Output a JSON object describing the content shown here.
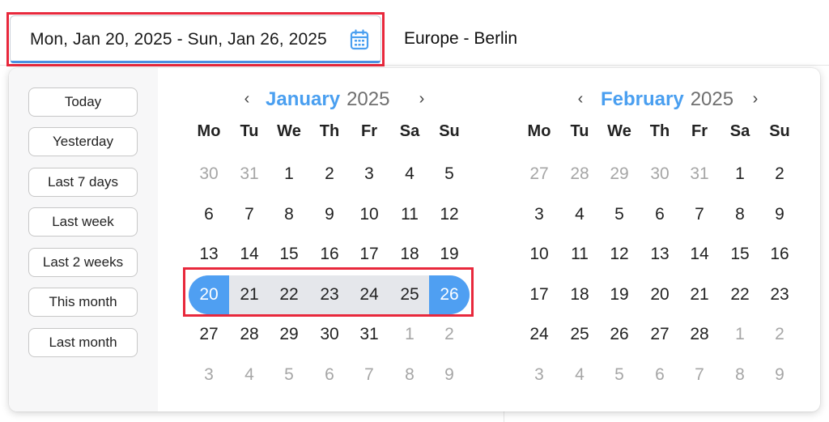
{
  "date_range": {
    "value": "Mon, Jan 20, 2025 - Sun, Jan 26, 2025",
    "icon": "calendar-icon"
  },
  "timezone": "Europe - Berlin",
  "presets": [
    "Today",
    "Yesterday",
    "Last 7 days",
    "Last week",
    "Last 2 weeks",
    "This month",
    "Last month"
  ],
  "weekdays": [
    "Mo",
    "Tu",
    "We",
    "Th",
    "Fr",
    "Sa",
    "Su"
  ],
  "months": [
    {
      "name": "January",
      "year": "2025",
      "weeks": [
        [
          {
            "d": "30",
            "muted": true
          },
          {
            "d": "31",
            "muted": true
          },
          {
            "d": "1"
          },
          {
            "d": "2"
          },
          {
            "d": "3"
          },
          {
            "d": "4"
          },
          {
            "d": "5"
          }
        ],
        [
          {
            "d": "6"
          },
          {
            "d": "7"
          },
          {
            "d": "8"
          },
          {
            "d": "9"
          },
          {
            "d": "10"
          },
          {
            "d": "11"
          },
          {
            "d": "12"
          }
        ],
        [
          {
            "d": "13"
          },
          {
            "d": "14"
          },
          {
            "d": "15"
          },
          {
            "d": "16"
          },
          {
            "d": "17"
          },
          {
            "d": "18"
          },
          {
            "d": "19"
          }
        ],
        [
          {
            "d": "20",
            "selected": true
          },
          {
            "d": "21",
            "inrange": true
          },
          {
            "d": "22",
            "inrange": true
          },
          {
            "d": "23",
            "inrange": true
          },
          {
            "d": "24",
            "inrange": true
          },
          {
            "d": "25",
            "inrange": true
          },
          {
            "d": "26",
            "selected": true
          }
        ],
        [
          {
            "d": "27"
          },
          {
            "d": "28"
          },
          {
            "d": "29"
          },
          {
            "d": "30"
          },
          {
            "d": "31"
          },
          {
            "d": "1",
            "muted": true
          },
          {
            "d": "2",
            "muted": true
          }
        ],
        [
          {
            "d": "3",
            "muted": true
          },
          {
            "d": "4",
            "muted": true
          },
          {
            "d": "5",
            "muted": true
          },
          {
            "d": "6",
            "muted": true
          },
          {
            "d": "7",
            "muted": true
          },
          {
            "d": "8",
            "muted": true
          },
          {
            "d": "9",
            "muted": true
          }
        ]
      ]
    },
    {
      "name": "February",
      "year": "2025",
      "weeks": [
        [
          {
            "d": "27",
            "muted": true
          },
          {
            "d": "28",
            "muted": true
          },
          {
            "d": "29",
            "muted": true
          },
          {
            "d": "30",
            "muted": true
          },
          {
            "d": "31",
            "muted": true
          },
          {
            "d": "1"
          },
          {
            "d": "2"
          }
        ],
        [
          {
            "d": "3"
          },
          {
            "d": "4"
          },
          {
            "d": "5"
          },
          {
            "d": "6"
          },
          {
            "d": "7"
          },
          {
            "d": "8"
          },
          {
            "d": "9"
          }
        ],
        [
          {
            "d": "10"
          },
          {
            "d": "11"
          },
          {
            "d": "12"
          },
          {
            "d": "13"
          },
          {
            "d": "14"
          },
          {
            "d": "15"
          },
          {
            "d": "16"
          }
        ],
        [
          {
            "d": "17"
          },
          {
            "d": "18"
          },
          {
            "d": "19"
          },
          {
            "d": "20"
          },
          {
            "d": "21"
          },
          {
            "d": "22"
          },
          {
            "d": "23"
          }
        ],
        [
          {
            "d": "24"
          },
          {
            "d": "25"
          },
          {
            "d": "26"
          },
          {
            "d": "27"
          },
          {
            "d": "28"
          },
          {
            "d": "1",
            "muted": true
          },
          {
            "d": "2",
            "muted": true
          }
        ],
        [
          {
            "d": "3",
            "muted": true
          },
          {
            "d": "4",
            "muted": true
          },
          {
            "d": "5",
            "muted": true
          },
          {
            "d": "6",
            "muted": true
          },
          {
            "d": "7",
            "muted": true
          },
          {
            "d": "8",
            "muted": true
          },
          {
            "d": "9",
            "muted": true
          }
        ]
      ]
    }
  ],
  "colors": {
    "accent": "#4f9ff2",
    "range_fill": "#e5e7eb",
    "annotation": "#e8283c"
  }
}
